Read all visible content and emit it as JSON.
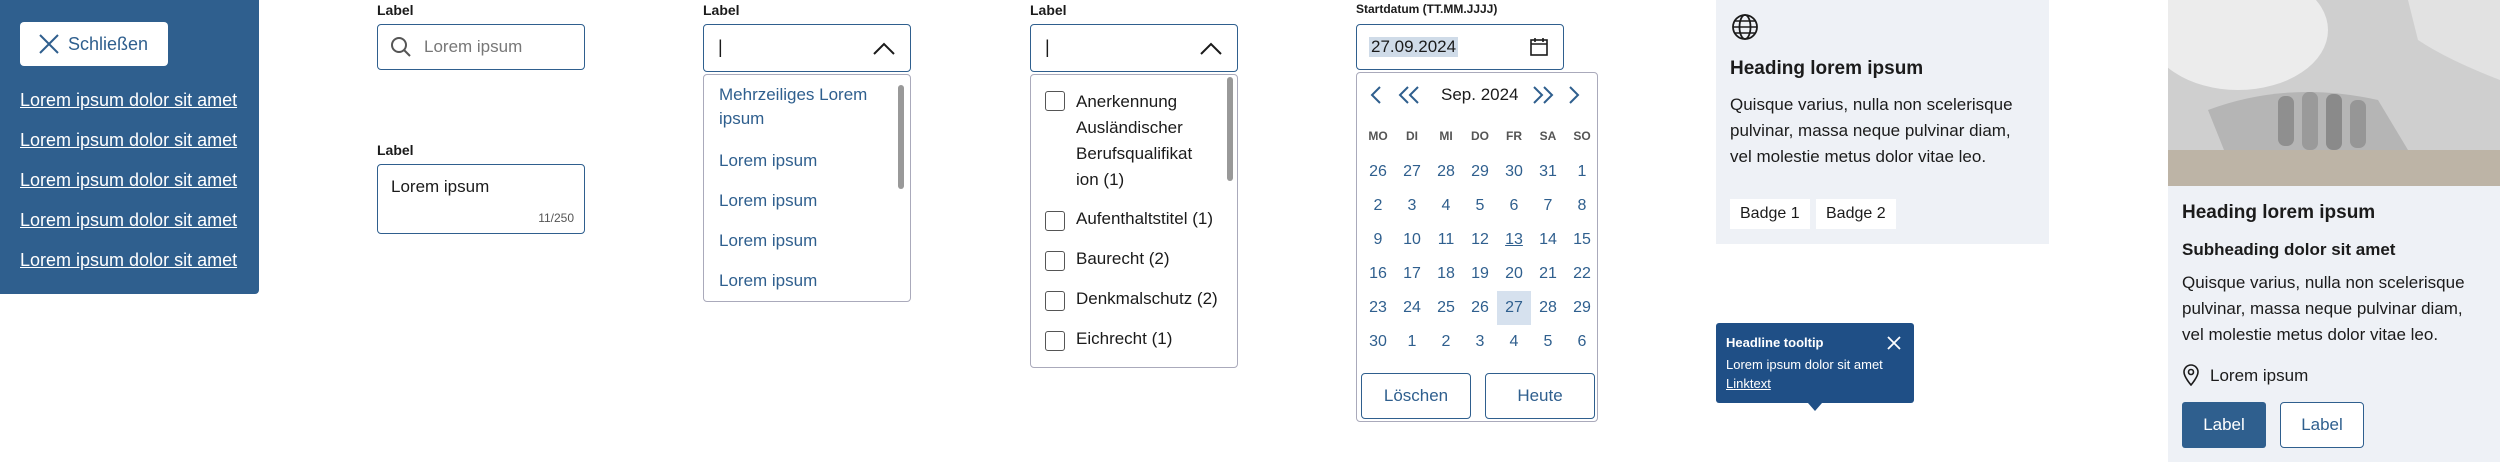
{
  "panel": {
    "close_label": "Schließen",
    "links": [
      "Lorem ipsum dolor sit amet",
      "Lorem ipsum dolor sit amet",
      "Lorem ipsum dolor sit amet",
      "Lorem ipsum dolor sit amet",
      "Lorem ipsum dolor sit amet"
    ]
  },
  "search": {
    "label": "Label",
    "placeholder": "Lorem ipsum"
  },
  "textarea": {
    "label": "Label",
    "value": "Lorem ipsum",
    "counter": "11/250"
  },
  "select": {
    "label": "Label",
    "value": "|",
    "options": [
      "Mehrzeiliges Lorem ipsum",
      "Lorem ipsum",
      "Lorem ipsum",
      "Lorem ipsum",
      "Lorem ipsum"
    ]
  },
  "multiselect": {
    "label": "Label",
    "value": "|",
    "options": [
      "Anerkennung Ausländischer Berufsqualifikat ion (1)",
      "Aufenthaltstitel (1)",
      "Baurecht (2)",
      "Denkmalschutz (2)",
      "Eichrecht (1)"
    ]
  },
  "datepicker": {
    "label": "Startdatum (TT.MM.JJJJ)",
    "value": "27.09.2024",
    "month": "Sep. 2024",
    "weekdays": [
      "MO",
      "DI",
      "MI",
      "DO",
      "FR",
      "SA",
      "SO"
    ],
    "days": [
      "26",
      "27",
      "28",
      "29",
      "30",
      "31",
      "1",
      "2",
      "3",
      "4",
      "5",
      "6",
      "7",
      "8",
      "9",
      "10",
      "11",
      "12",
      "13",
      "14",
      "15",
      "16",
      "17",
      "18",
      "19",
      "20",
      "21",
      "22",
      "23",
      "24",
      "25",
      "26",
      "27",
      "28",
      "29",
      "30",
      "1",
      "2",
      "3",
      "4",
      "5",
      "6"
    ],
    "clear_label": "Löschen",
    "today_label": "Heute"
  },
  "info_card": {
    "heading": "Heading lorem ipsum",
    "text": "Quisque varius, nulla non scelerisque pulvinar, massa neque pulvinar diam, vel molestie metus dolor vitae leo.",
    "badges": [
      "Badge 1",
      "Badge 2"
    ]
  },
  "tooltip": {
    "headline": "Headline tooltip",
    "text": "Lorem ipsum dolor sit amet",
    "link": "Linktext"
  },
  "image_card": {
    "heading": "Heading lorem ipsum",
    "subheading": "Subheading dolor sit amet",
    "text": "Quisque varius, nulla non scelerisque pulvinar, massa neque pulvinar diam, vel molestie metus dolor vitae leo.",
    "location": "Lorem ipsum",
    "primary_label": "Label",
    "secondary_label": "Label"
  },
  "colors": {
    "primary": "#2f5f8e",
    "card_bg": "#eef1f6",
    "tooltip_bg": "#1f4f86"
  }
}
